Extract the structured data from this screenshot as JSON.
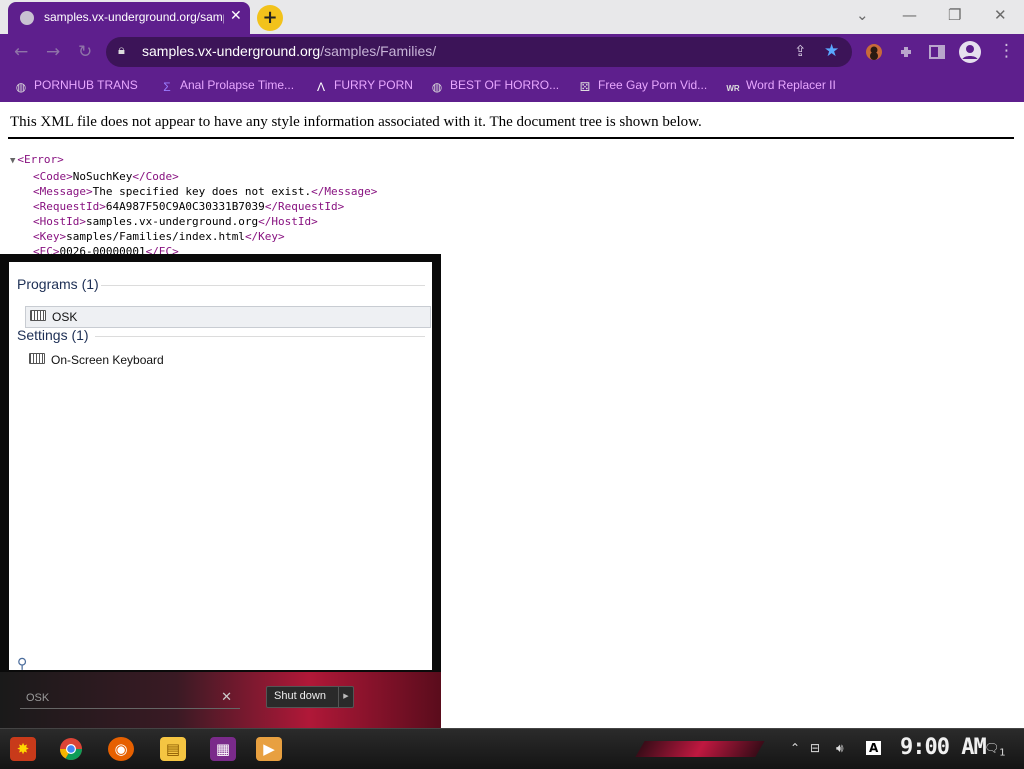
{
  "browser": {
    "tab_title": "samples.vx-underground.org/samples/Families/",
    "tab_close": "✕",
    "new_tab": "+",
    "window_controls": {
      "dropdown": "⌄",
      "minimize": "—",
      "restore": "❐",
      "close": "✕"
    },
    "url_host": "samples.vx-underground.org",
    "url_path": "/samples/Families/"
  },
  "bookmarks": [
    {
      "label": "PORNHUB TRANS",
      "icon": "globe-icon"
    },
    {
      "label": "Anal Prolapse Time...",
      "icon": "sigma-icon"
    },
    {
      "label": "FURRY PORN",
      "icon": "lambda-icon"
    },
    {
      "label": "BEST OF HORRO...",
      "icon": "globe-icon"
    },
    {
      "label": "Free Gay Porn Vid...",
      "icon": "dice-icon"
    },
    {
      "label": "Word Replacer II",
      "icon": "wr-icon"
    }
  ],
  "xml": {
    "info": "This XML file does not appear to have any style information associated with it. The document tree is shown below.",
    "root_open": "<Error>",
    "rows": [
      {
        "open": "<Code>",
        "text": "NoSuchKey",
        "close": "</Code>"
      },
      {
        "open": "<Message>",
        "text": "The specified key does not exist.",
        "close": "</Message>"
      },
      {
        "open": "<RequestId>",
        "text": "64A987F50C9A0C30331B7039",
        "close": "</RequestId>"
      },
      {
        "open": "<HostId>",
        "text": "samples.vx-underground.org",
        "close": "</HostId>"
      },
      {
        "open": "<Key>",
        "text": "samples/Families/index.html",
        "close": "</Key>"
      },
      {
        "open": "<EC>",
        "text": "0026-00000001",
        "close": "</EC>"
      }
    ]
  },
  "start_menu": {
    "programs_header": "Programs (1)",
    "program_item": "OSK",
    "settings_header": "Settings (1)",
    "settings_item": "On-Screen Keyboard",
    "search_value": "OSK",
    "clear": "✕",
    "shutdown_label": "Shut down",
    "shutdown_arrow": "▶"
  },
  "taskbar": {
    "clock": "9:00 AM",
    "notification_count": "1"
  },
  "colors": {
    "browser_frame": "#5e1f8d",
    "omnibox": "#3c1458",
    "bookmark_text": "#e8a7ff",
    "xml_tag": "#881280",
    "star": "#5aa9ff"
  }
}
